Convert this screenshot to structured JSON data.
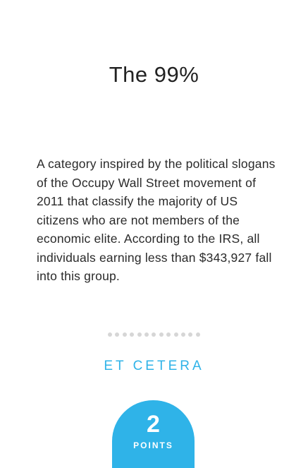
{
  "card": {
    "title": "The 99%",
    "description": "A category inspired by the political slogans of the Occupy Wall Street movement of 2011 that classify the majority of US citizens who are not members of the economic elite. According to the IRS, all individuals earning less than $343,927 fall into this group.",
    "divider_dot_count": 13,
    "category": "ET CETERA",
    "points": {
      "value": "2",
      "label": "POINTS"
    }
  },
  "colors": {
    "accent": "#2fb3e8",
    "text": "#222222",
    "divider": "#d6d6d6",
    "background": "#ffffff"
  }
}
